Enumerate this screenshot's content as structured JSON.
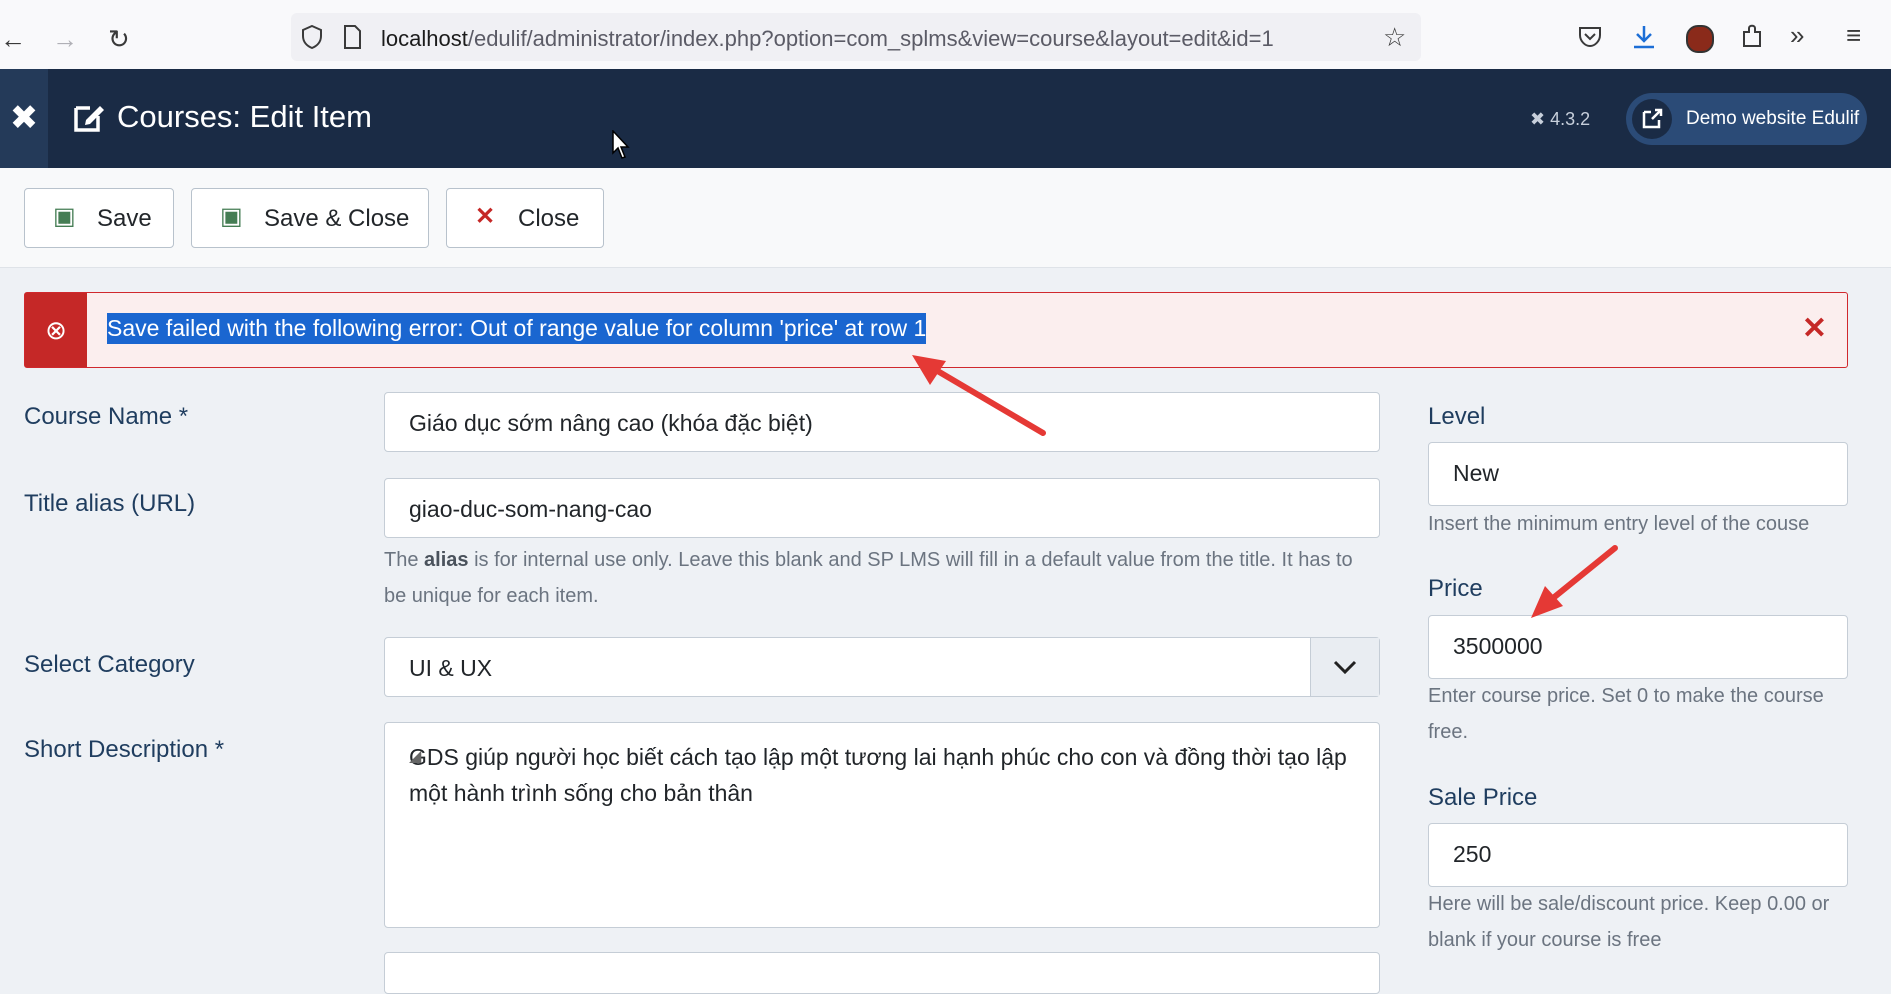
{
  "browser": {
    "url_host": "localhost",
    "url_path": "/edulif/administrator/index.php?option=com_splms&view=course&layout=edit&id=1",
    "back_icon": "back-arrow-icon",
    "forward_icon": "forward-arrow-icon",
    "reload_icon": "reload-icon"
  },
  "header": {
    "title": "Courses: Edit Item",
    "version": "4.3.2",
    "site_button": "Demo website Edulif"
  },
  "toolbar": {
    "save": "Save",
    "save_close": "Save & Close",
    "close": "Close"
  },
  "alert": {
    "message": "Save failed with the following error: Out of range value for column 'price' at row 1"
  },
  "form": {
    "course_name": {
      "label": "Course Name *",
      "value": "Giáo dục sớm nâng cao (khóa đặc biệt)"
    },
    "alias": {
      "label": "Title alias (URL)",
      "value": "giao-duc-som-nang-cao",
      "help_prefix": "The ",
      "help_bold": "alias",
      "help_suffix": " is for internal use only. Leave this blank and SP LMS will fill in a default value from the title. It has to be unique for each item."
    },
    "category": {
      "label": "Select Category",
      "value": "UI & UX"
    },
    "short_description": {
      "label": "Short Description *",
      "value": "GDS giúp người học biết cách tạo lập một tương lai hạnh phúc cho con và đồng thời tạo lập một hành trình sống cho bản thân"
    },
    "level": {
      "label": "Level",
      "value": "New",
      "help": "Insert the minimum entry level of the couse"
    },
    "price": {
      "label": "Price",
      "value": "3500000",
      "help": "Enter course price. Set 0 to make the course free."
    },
    "sale_price": {
      "label": "Sale Price",
      "value": "250",
      "help": "Here will be sale/discount price. Keep 0.00 or blank if your course is free"
    }
  },
  "colors": {
    "header": "#1a2b45",
    "error": "#c52827",
    "selection": "#1a66d0",
    "annotation_arrow": "#e53935"
  }
}
